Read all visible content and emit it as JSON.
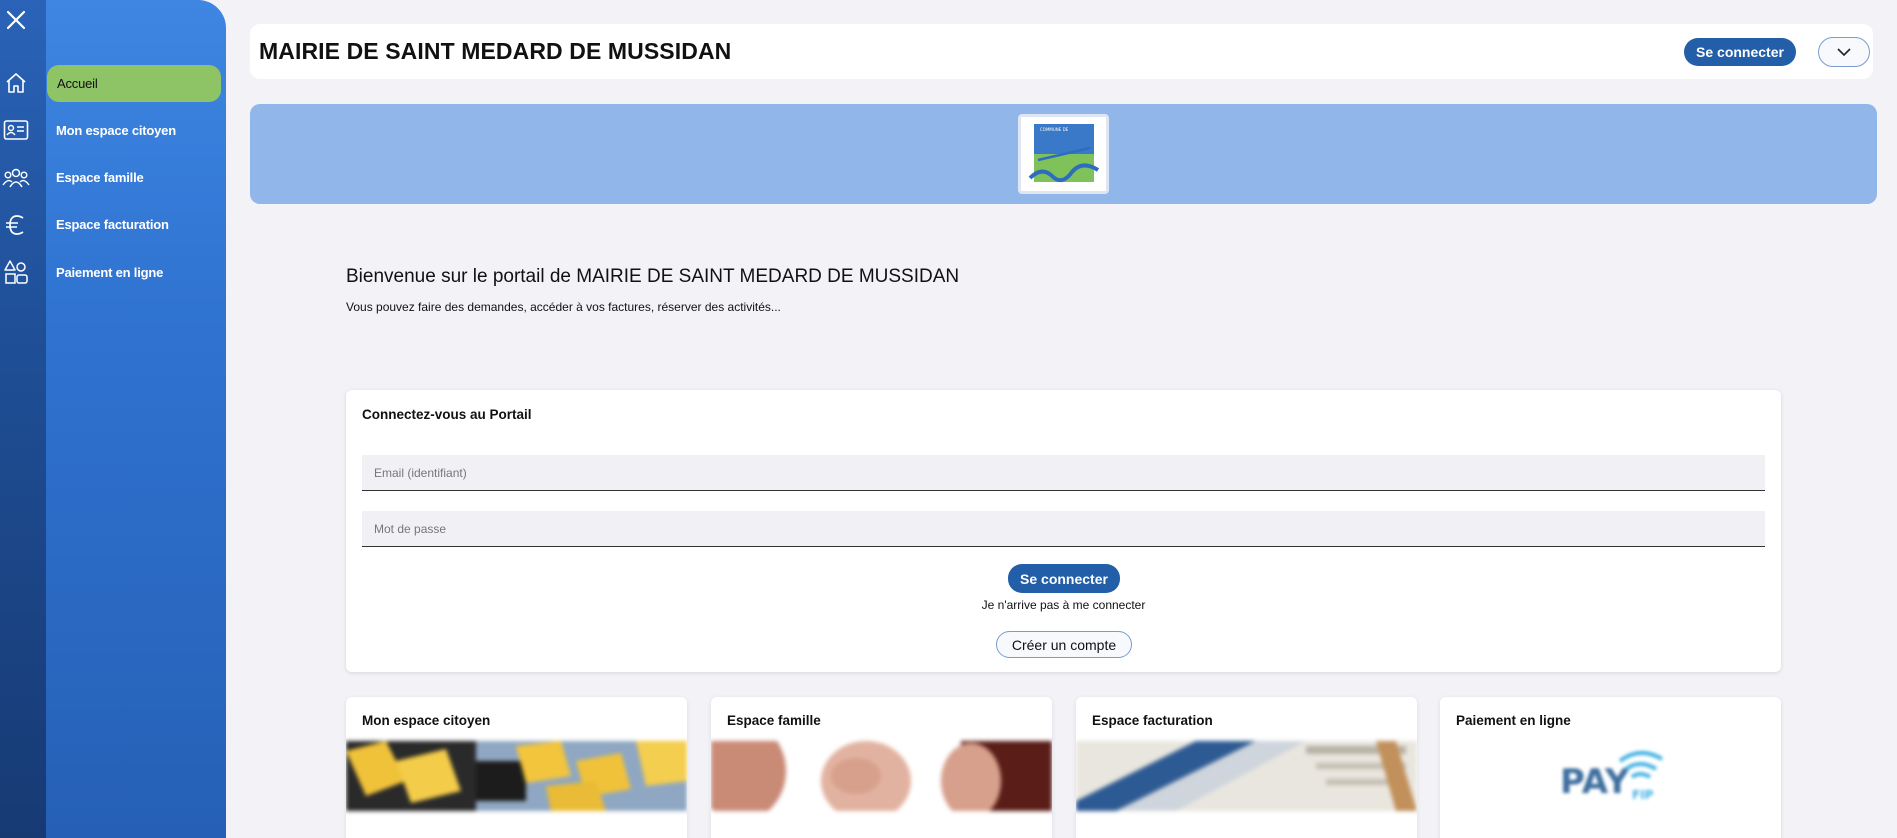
{
  "sidebar": {
    "close_icon": "close-icon",
    "icons": [
      "home-icon",
      "id-card-icon",
      "family-icon",
      "euro-icon",
      "shapes-icon"
    ],
    "items": [
      {
        "label": "Accueil",
        "active": true
      },
      {
        "label": "Mon espace citoyen",
        "active": false
      },
      {
        "label": "Espace famille",
        "active": false
      },
      {
        "label": "Espace facturation",
        "active": false
      },
      {
        "label": "Paiement en ligne",
        "active": false
      }
    ]
  },
  "header": {
    "title": "MAIRIE DE SAINT MEDARD DE MUSSIDAN",
    "login_label": "Se connecter",
    "dropdown_icon": "chevron-down-icon"
  },
  "banner": {
    "logo_icon": "municipality-logo-icon"
  },
  "welcome": {
    "title": "Bienvenue sur le portail de MAIRIE DE SAINT MEDARD DE MUSSIDAN",
    "subtitle": "Vous pouvez faire des demandes, accéder à vos factures, réserver des activités..."
  },
  "login_card": {
    "title": "Connectez-vous au Portail",
    "email_placeholder": "Email (identifiant)",
    "password_placeholder": "Mot de passe",
    "submit_label": "Se connecter",
    "forgot_label": "Je n'arrive pas à me connecter",
    "create_label": "Créer un compte"
  },
  "tiles": [
    {
      "title": "Mon espace citoyen"
    },
    {
      "title": "Espace famille"
    },
    {
      "title": "Espace facturation"
    },
    {
      "title": "Paiement en ligne",
      "logo_text": "PAY",
      "logo_sub": "FIP"
    }
  ],
  "colors": {
    "sidebar_dark": "#1f4f97",
    "sidebar_panel": "#2f72d0",
    "active_item": "#8ec366",
    "primary_button": "#235ea8",
    "banner": "#91b6ea",
    "background": "#f3f3f7"
  }
}
